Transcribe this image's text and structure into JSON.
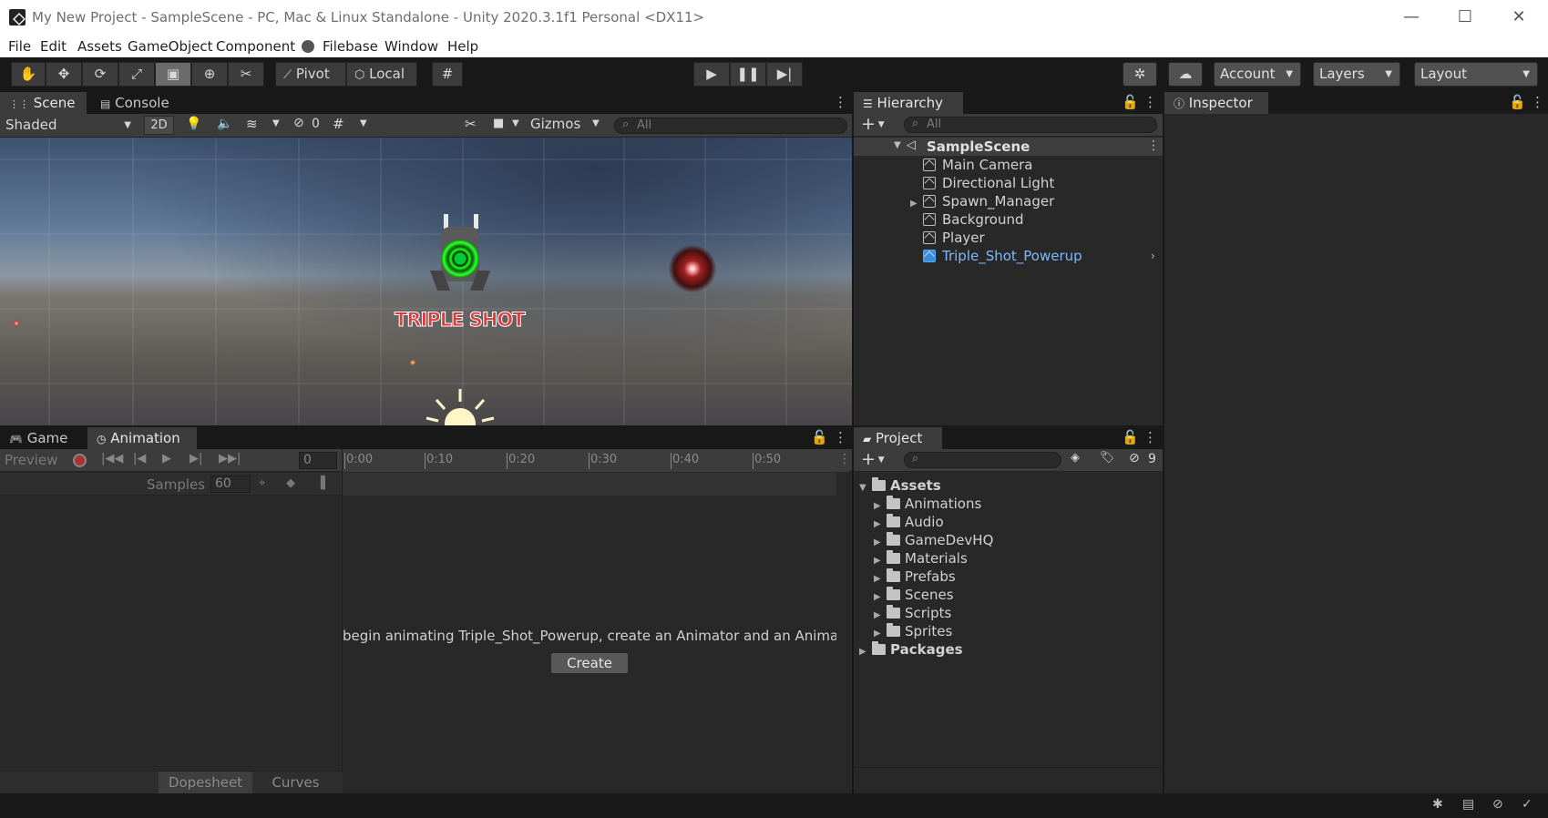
{
  "window": {
    "title": "My New Project - SampleScene - PC, Mac & Linux Standalone - Unity 2020.3.1f1 Personal <DX11>",
    "minimize": "—",
    "maximize": "☐",
    "close": "✕"
  },
  "menu": [
    "File",
    "Edit",
    "Assets",
    "GameObject",
    "Component",
    "Filebase",
    "Window",
    "Help"
  ],
  "toolbar": {
    "pivot": "Pivot",
    "local": "Local",
    "account": "Account",
    "layers": "Layers",
    "layout": "Layout"
  },
  "scene": {
    "tabs": [
      "Scene",
      "Console"
    ],
    "shading": "Shaded",
    "mode_2d": "2D",
    "hidden_count": "0",
    "gizmos": "Gizmos",
    "search_placeholder": "All",
    "powerup_label": "TRIPLE SHOT"
  },
  "hierarchy": {
    "tab": "Hierarchy",
    "search_placeholder": "All",
    "scene_name": "SampleScene",
    "items": [
      "Main Camera",
      "Directional Light",
      "Spawn_Manager",
      "Background",
      "Player",
      "Triple_Shot_Powerup"
    ]
  },
  "inspector": {
    "tab": "Inspector"
  },
  "animation": {
    "tabs": [
      "Game",
      "Animation"
    ],
    "preview": "Preview",
    "frame": "0",
    "samples_label": "Samples",
    "samples_value": "60",
    "ticks": [
      "0:00",
      "0:10",
      "0:20",
      "0:30",
      "0:40",
      "0:50"
    ],
    "message": "begin animating Triple_Shot_Powerup, create an Animator and an Animation C",
    "create_button": "Create",
    "dopesheet": "Dopesheet",
    "curves": "Curves"
  },
  "project": {
    "tab": "Project",
    "hidden_count": "9",
    "assets": "Assets",
    "folders": [
      "Animations",
      "Audio",
      "GameDevHQ",
      "Materials",
      "Prefabs",
      "Scenes",
      "Scripts",
      "Sprites"
    ],
    "packages": "Packages"
  },
  "colors": {
    "selected_item": "#7fb8ff",
    "editor_bg": "#282828",
    "toolbar_bg": "#191919"
  }
}
